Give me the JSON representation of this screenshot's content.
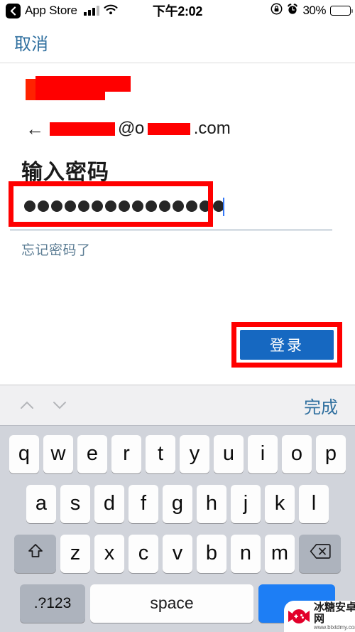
{
  "status_bar": {
    "back_app_label": "App Store",
    "back_icon": "chevron-left-icon",
    "signal_icon": "cellular-signal-icon",
    "wifi_icon": "wifi-icon",
    "time": "下午2:02",
    "rotation_lock_icon": "rotation-lock-icon",
    "alarm_icon": "alarm-clock-icon",
    "battery_percent": "30%",
    "battery_level": 30
  },
  "nav": {
    "cancel_label": "取消"
  },
  "form": {
    "account_logo_redacted": true,
    "email_back_arrow": "←",
    "email_at_symbol": "@o",
    "email_domain_suffix": ".com",
    "prompt_title": "输入密码",
    "password_value": "●●●●●●●●●●●●●●●",
    "password_dot_count": 15,
    "forgot_password_label": "忘记密码了",
    "login_label": "登录"
  },
  "highlights": {
    "color": "#ff0000",
    "password_field_highlighted": true,
    "login_button_highlighted": true
  },
  "keyboard": {
    "toolbar": {
      "prev_icon": "chevron-up-icon",
      "next_icon": "chevron-down-icon",
      "done_label": "完成"
    },
    "row1": [
      "q",
      "w",
      "e",
      "r",
      "t",
      "y",
      "u",
      "i",
      "o",
      "p"
    ],
    "row2": [
      "a",
      "s",
      "d",
      "f",
      "g",
      "h",
      "j",
      "k",
      "l"
    ],
    "row3": [
      "z",
      "x",
      "c",
      "v",
      "b",
      "n",
      "m"
    ],
    "shift_icon": "shift-arrow-icon",
    "delete_icon": "backspace-icon",
    "numbers_label": ".?123",
    "space_label": "space",
    "go_label": ""
  },
  "watermark": {
    "site_name": "冰糖安卓网",
    "url": "www.btxtdmy.com",
    "logo_icon": "candy-gamepad-logo-icon",
    "logo_color": "#e2002a"
  },
  "colors": {
    "accent_blue": "#2f6f9f",
    "button_blue": "#1668c1",
    "highlight_red": "#ff0000",
    "keyboard_bg": "#d1d4db"
  }
}
